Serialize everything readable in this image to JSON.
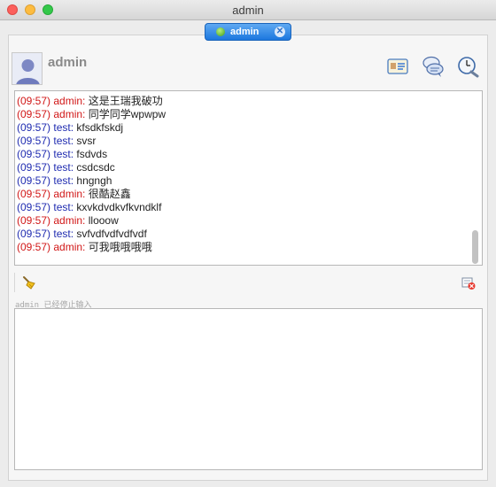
{
  "window": {
    "title": "admin"
  },
  "tab": {
    "label": "admin"
  },
  "header": {
    "name": "admin",
    "icons": [
      "contact-card-icon",
      "chat-bubbles-icon",
      "alarm-clock-icon"
    ]
  },
  "messages": [
    {
      "time": "(09:57)",
      "sender": "admin:",
      "text": "这是王瑞我破功",
      "type": "admin"
    },
    {
      "time": "(09:57)",
      "sender": "admin:",
      "text": "同学同学wpwpw",
      "type": "admin"
    },
    {
      "time": "(09:57)",
      "sender": "test:",
      "text": "kfsdkfskdj",
      "type": "test"
    },
    {
      "time": "(09:57)",
      "sender": "test:",
      "text": "svsr",
      "type": "test"
    },
    {
      "time": "(09:57)",
      "sender": "test:",
      "text": "fsdvds",
      "type": "test"
    },
    {
      "time": "(09:57)",
      "sender": "test:",
      "text": "csdcsdc",
      "type": "test"
    },
    {
      "time": "(09:57)",
      "sender": "test:",
      "text": "hngngh",
      "type": "test"
    },
    {
      "time": "(09:57)",
      "sender": "admin:",
      "text": "很酷赵鑫",
      "type": "admin"
    },
    {
      "time": "(09:57)",
      "sender": "test:",
      "text": "kxvkdvdkvfkvndklf",
      "type": "test"
    },
    {
      "time": "(09:57)",
      "sender": "admin:",
      "text": "llooow",
      "type": "admin"
    },
    {
      "time": "(09:57)",
      "sender": "test:",
      "text": "svfvdfvdfvdfvdf",
      "type": "test"
    },
    {
      "time": "(09:57)",
      "sender": "admin:",
      "text": "可我哦哦哦哦",
      "type": "admin"
    }
  ],
  "toolbar": {
    "left_icon": "broom-icon",
    "right_icon": "clear-history-icon"
  },
  "status": {
    "text": "admin 已经停止输入"
  },
  "colors": {
    "admin": "#d11717",
    "test": "#1f2bb0",
    "tab_accent": "#1c77de"
  }
}
